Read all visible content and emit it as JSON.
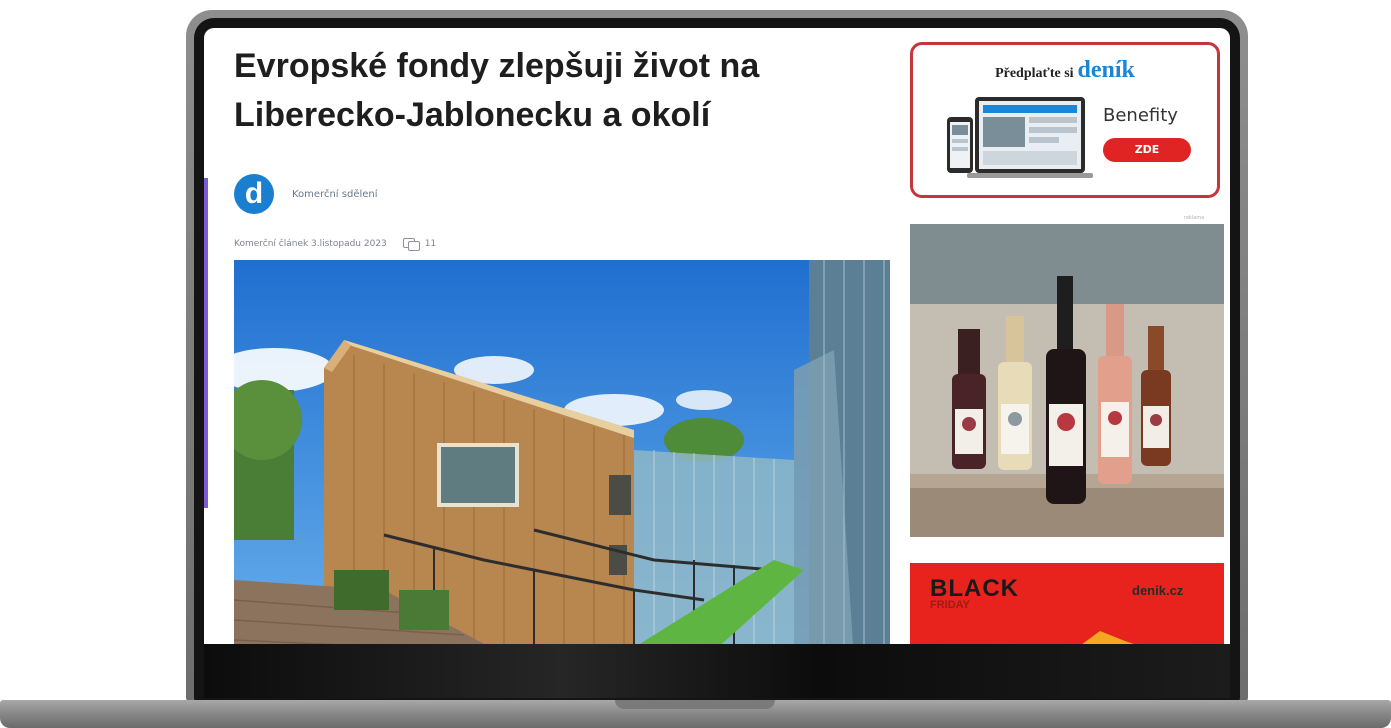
{
  "article": {
    "headline": "Evropské fondy zlepšuji život na Liberecko-Jablonecku a okolí",
    "avatar_letter": "d",
    "author": "Komerční sdělení",
    "date": "Komerční článek 3.listopadu 2023",
    "comment_count": "11"
  },
  "sidebar": {
    "promo_text": "Předplaťte si",
    "promo_brand": "deník",
    "benefits_label": "Benefity",
    "zde_button": "ZDE",
    "ad_label": "reklama",
    "bf_title": "BLACK",
    "bf_subtitle": "FRIDAY",
    "bf_logo": "denik.cz"
  },
  "colors": {
    "accent_red": "#e02424",
    "brand_blue": "#1b86d6",
    "bf_red": "#e8231d"
  },
  "icons": [
    "avatar-d-logo",
    "comment-icon"
  ]
}
